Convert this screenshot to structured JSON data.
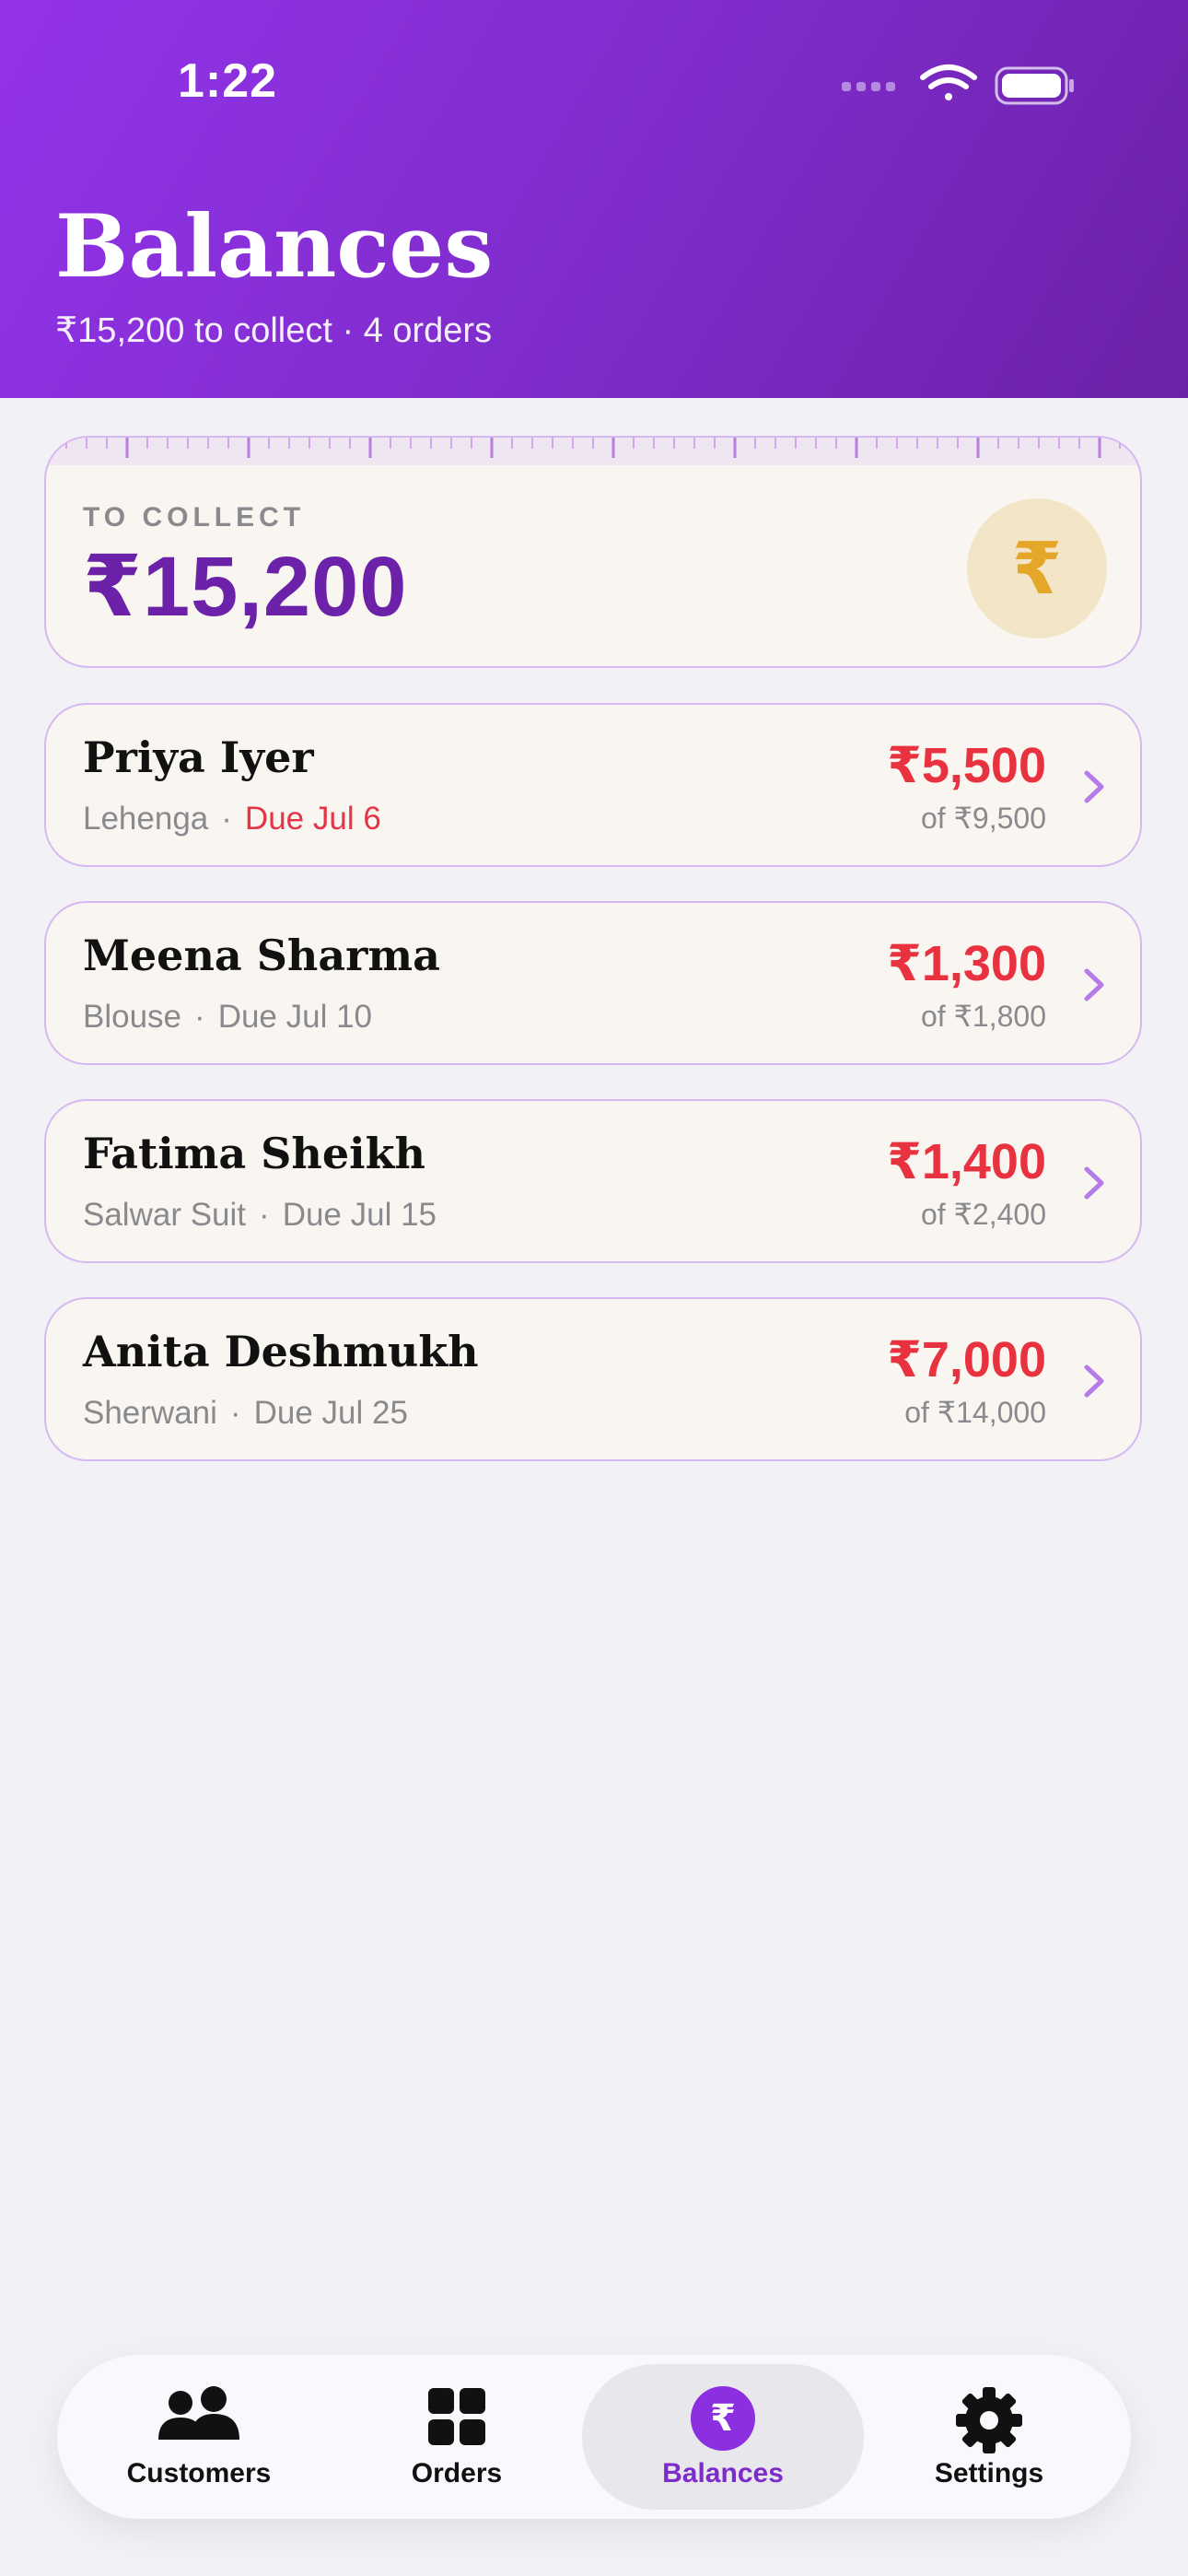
{
  "status_bar": {
    "time": "1:22"
  },
  "header": {
    "title": "Balances",
    "subtitle": "₹15,200 to collect · 4 orders"
  },
  "summary": {
    "label": "TO COLLECT",
    "amount": "₹15,200",
    "icon": "rupee-icon",
    "icon_glyph": "₹"
  },
  "orders": [
    {
      "name": "Priya Iyer",
      "garment": "Lehenga",
      "due": "Due Jul 6",
      "overdue": true,
      "balance": "₹5,500",
      "total": "of ₹9,500"
    },
    {
      "name": "Meena Sharma",
      "garment": "Blouse",
      "due": "Due Jul 10",
      "overdue": false,
      "balance": "₹1,300",
      "total": "of ₹1,800"
    },
    {
      "name": "Fatima Sheikh",
      "garment": "Salwar Suit",
      "due": "Due Jul 15",
      "overdue": false,
      "balance": "₹1,400",
      "total": "of ₹2,400"
    },
    {
      "name": "Anita Deshmukh",
      "garment": "Sherwani",
      "due": "Due Jul 25",
      "overdue": false,
      "balance": "₹7,000",
      "total": "of ₹14,000"
    }
  ],
  "tab_bar": {
    "tabs": [
      {
        "label": "Customers",
        "icon": "people-icon"
      },
      {
        "label": "Orders",
        "icon": "grid-icon"
      },
      {
        "label": "Balances",
        "icon": "rupee-icon",
        "glyph": "₹",
        "active": true
      },
      {
        "label": "Settings",
        "icon": "gear-icon"
      }
    ]
  },
  "colors": {
    "header_start": "#9333ea",
    "header_end": "#6b21a8",
    "accent": "#7e2cc9",
    "balance_red": "#e8323f",
    "card_bg": "#f9f6f1",
    "card_border": "#d6b8f2"
  }
}
